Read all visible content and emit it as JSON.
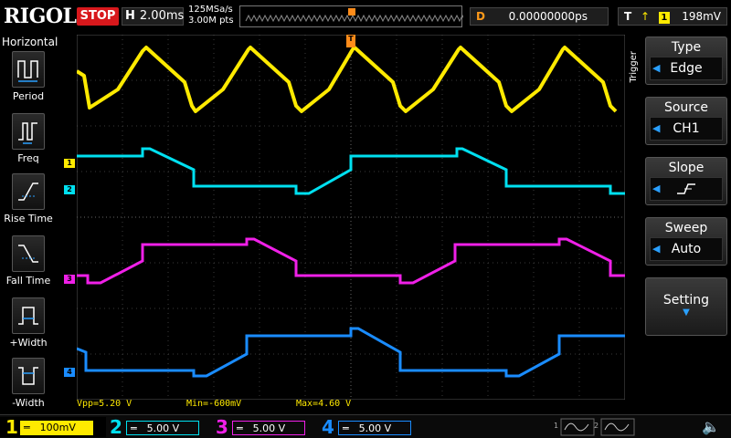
{
  "top": {
    "brand": "RIGOL",
    "run_state": "STOP",
    "timebase_label": "H",
    "timebase_value": "2.00ms",
    "sample_rate": "125MSa/s",
    "mem_depth": "3.00M pts",
    "delay_label": "D",
    "delay_value": "0.00000000ps",
    "trigger_label": "T",
    "trigger_source_num": "1",
    "trigger_level": "198mV"
  },
  "left": {
    "title": "Horizontal",
    "items": [
      {
        "label": "Period",
        "icon": "period-icon"
      },
      {
        "label": "Freq",
        "icon": "freq-icon"
      },
      {
        "label": "Rise Time",
        "icon": "rise-time-icon"
      },
      {
        "label": "Fall Time",
        "icon": "fall-time-icon"
      },
      {
        "label": "+Width",
        "icon": "pos-width-icon"
      },
      {
        "label": "-Width",
        "icon": "neg-width-icon"
      }
    ]
  },
  "right": {
    "side_label": "Trigger",
    "type_head": "Type",
    "type_val": "Edge",
    "source_head": "Source",
    "source_val": "CH1",
    "slope_head": "Slope",
    "slope_val": "rising-edge-icon",
    "sweep_head": "Sweep",
    "sweep_val": "Auto",
    "setting_head": "Setting"
  },
  "channels": {
    "c1": {
      "num": "1",
      "scale": "100mV",
      "color": "#ffea00"
    },
    "c2": {
      "num": "2",
      "scale": "5.00 V",
      "color": "#00e0f0"
    },
    "c3": {
      "num": "3",
      "scale": "5.00 V",
      "color": "#f020e8"
    },
    "c4": {
      "num": "4",
      "scale": "5.00 V",
      "color": "#1a8cff"
    }
  },
  "markers": {
    "m1": "1",
    "m2": "2",
    "m3": "3",
    "m4": "4"
  },
  "measurements": {
    "vpp": "Vpp=5.20 V",
    "min": "Min=-600mV",
    "max": "Max=4.60 V"
  }
}
